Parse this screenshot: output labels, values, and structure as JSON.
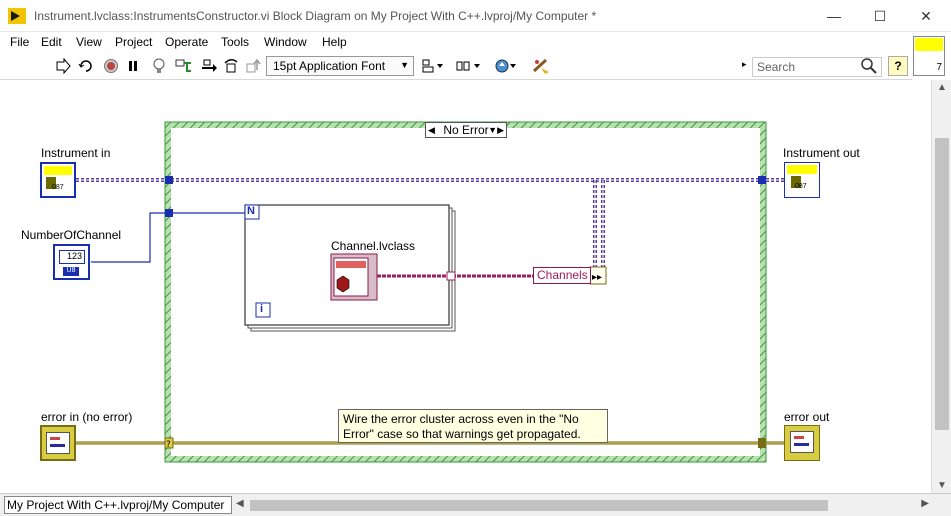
{
  "window": {
    "title": "Instrument.lvclass:InstrumentsConstructor.vi Block Diagram on My Project With C++.lvproj/My Computer *",
    "minimize_glyph": "—",
    "maximize_glyph": "☐",
    "close_glyph": "✕"
  },
  "menu": [
    "File",
    "Edit",
    "View",
    "Project",
    "Operate",
    "Tools",
    "Window",
    "Help"
  ],
  "toolbar": {
    "icons": [
      "run-arrow-icon",
      "run-continuously-icon",
      "abort-icon",
      "pause-icon",
      "highlight-execution-icon",
      "retain-wire-values-icon",
      "step-into-icon",
      "step-over-icon",
      "step-out-icon",
      "align-objects-icon",
      "distribute-objects-icon",
      "reorder-icon",
      "clean-up-diagram-icon"
    ],
    "font_label": "15pt Application Font",
    "search_placeholder": "Search",
    "help_label": "?"
  },
  "connector_pane": {
    "number": "7"
  },
  "diagram": {
    "controls": {
      "instrument_in": "Instrument in",
      "number_of_channel": "NumberOfChannel",
      "error_in": "error in (no error)"
    },
    "indicators": {
      "instrument_out": "Instrument out",
      "error_out": "error out"
    },
    "case_structure": {
      "selected_case": "No Error"
    },
    "for_loop": {
      "count_terminal": "N",
      "iteration_terminal": "i"
    },
    "class_constant": {
      "label": "Channel.lvclass"
    },
    "bundle_by_name": {
      "element": "Channels"
    },
    "numeric_terminal": {
      "display": "123",
      "type": "U8"
    },
    "class_terminal_type": "087",
    "error_selector_glyph": "?",
    "comment": "Wire the error cluster across even in the \"No Error\" case so that warnings get propagated."
  },
  "status": {
    "path": "My Project With C++.lvproj/My Computer"
  },
  "colors": {
    "class_wire": "#5b3fa0",
    "numeric_wire": "#1a2fb0",
    "error_wire": "#7a6b16",
    "case_border": "#3a9a3a",
    "channel_wire": "#9b1e5e"
  }
}
